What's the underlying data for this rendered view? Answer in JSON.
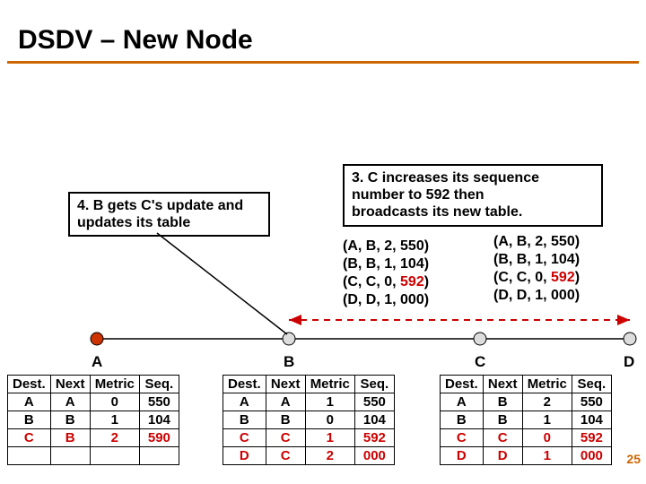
{
  "title": "DSDV – New Node",
  "notes": {
    "step4": "4. B gets C's update and updates its table",
    "step3_l1": "3. C increases its sequence",
    "step3_l2": "number to 592 then",
    "step3_l3": "broadcasts its new table."
  },
  "tuples_left": [
    {
      "pre": "(A, B, 2, ",
      "hl": "",
      "post": "550)"
    },
    {
      "pre": "(B, B, 1, ",
      "hl": "",
      "post": "104)"
    },
    {
      "pre": "(C, C, 0, ",
      "hl": "592",
      "post": ")"
    },
    {
      "pre": "(D, D, 1, ",
      "hl": "",
      "post": "000)"
    }
  ],
  "tuples_right": [
    {
      "pre": "(A, B, 2, ",
      "hl": "",
      "post": "550)"
    },
    {
      "pre": "(B, B, 1, ",
      "hl": "",
      "post": "104)"
    },
    {
      "pre": "(C, C, 0, ",
      "hl": "592",
      "post": ")"
    },
    {
      "pre": "(D, D, 1, ",
      "hl": "",
      "post": "000)"
    }
  ],
  "nodes": {
    "A": "A",
    "B": "B",
    "C": "C",
    "D": "D"
  },
  "headers": {
    "dest": "Dest.",
    "next": "Next",
    "metric": "Metric",
    "seq": "Seq."
  },
  "tableA": [
    {
      "dest": "A",
      "next": "A",
      "metric": "0",
      "seq": "550",
      "hl": false
    },
    {
      "dest": "B",
      "next": "B",
      "metric": "1",
      "seq": "104",
      "hl": false
    },
    {
      "dest": "C",
      "next": "B",
      "metric": "2",
      "seq": "590",
      "hl": true
    },
    {
      "dest": "",
      "next": "",
      "metric": "",
      "seq": "",
      "hl": false
    }
  ],
  "tableB": [
    {
      "dest": "A",
      "next": "A",
      "metric": "1",
      "seq": "550",
      "hl": false
    },
    {
      "dest": "B",
      "next": "B",
      "metric": "0",
      "seq": "104",
      "hl": false
    },
    {
      "dest": "C",
      "next": "C",
      "metric": "1",
      "seq": "592",
      "hl": true
    },
    {
      "dest": "D",
      "next": "C",
      "metric": "2",
      "seq": "000",
      "hl": true
    }
  ],
  "tableC": [
    {
      "dest": "A",
      "next": "B",
      "metric": "2",
      "seq": "550",
      "hl": false
    },
    {
      "dest": "B",
      "next": "B",
      "metric": "1",
      "seq": "104",
      "hl": false
    },
    {
      "dest": "C",
      "next": "C",
      "metric": "0",
      "seq": "592",
      "hl": true
    },
    {
      "dest": "D",
      "next": "D",
      "metric": "1",
      "seq": "000",
      "hl": true
    }
  ],
  "page": "25"
}
